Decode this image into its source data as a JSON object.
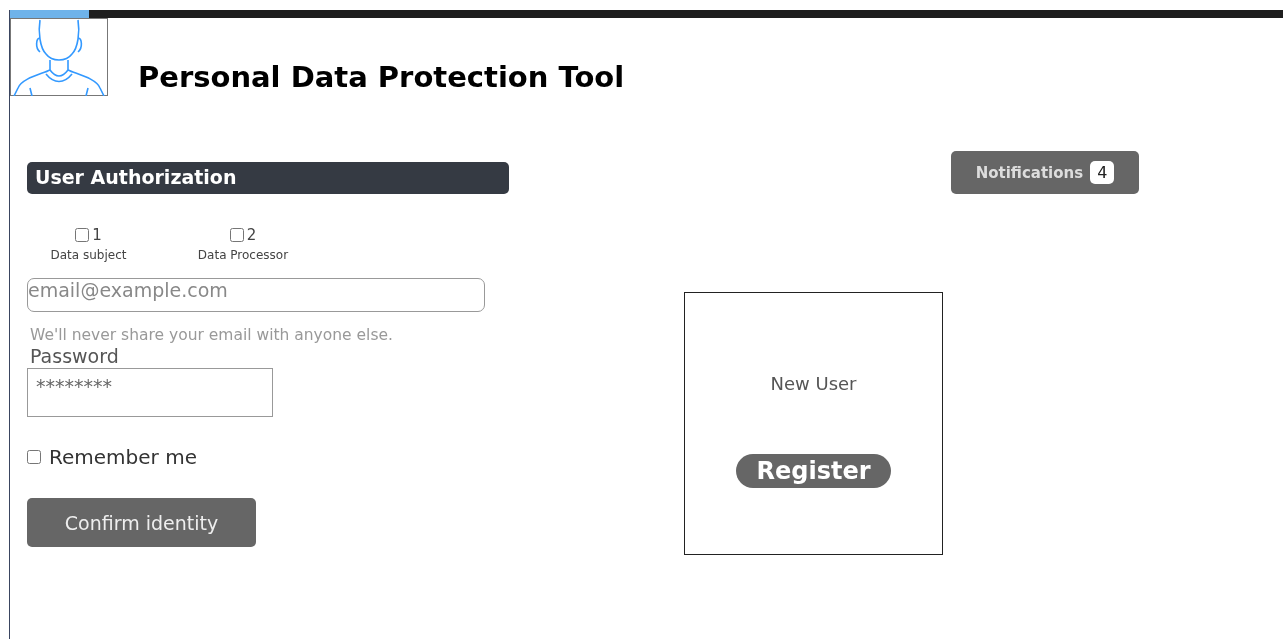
{
  "header": {
    "title": "Personal Data Protection Tool"
  },
  "notifications": {
    "label": "Notifications",
    "count": "4"
  },
  "auth": {
    "heading": "User Authorization",
    "roles": [
      {
        "number": "1",
        "label": "Data subject",
        "checked": false
      },
      {
        "number": "2",
        "label": "Data Processor",
        "checked": false
      }
    ],
    "email": {
      "placeholder": "email@example.com"
    },
    "email_hint": "We'll never share your email with anyone else.",
    "password": {
      "label": "Password",
      "value": "********"
    },
    "remember": {
      "label": "Remember me",
      "checked": false
    },
    "submit": "Confirm identity"
  },
  "new_user": {
    "title": "New User",
    "button": "Register"
  }
}
